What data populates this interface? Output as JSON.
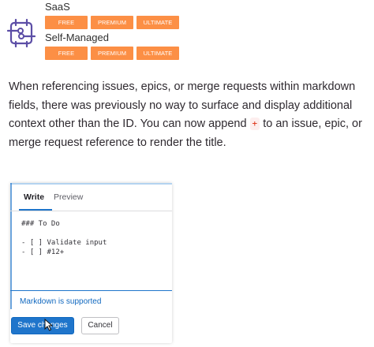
{
  "tiers": {
    "saas": {
      "title": "SaaS",
      "badges": [
        "FREE",
        "PREMIUM",
        "ULTIMATE"
      ]
    },
    "self_managed": {
      "title": "Self-Managed",
      "badges": [
        "FREE",
        "PREMIUM",
        "ULTIMATE"
      ]
    }
  },
  "description": {
    "before": "When referencing issues, epics, or merge requests within markdown fields, there was previously no way to surface and display additional context other than the ID. You can now append",
    "code": "+",
    "after": "to an issue, epic, or merge request reference to render the title."
  },
  "editor": {
    "tabs": {
      "write": "Write",
      "preview": "Preview"
    },
    "content": "### To Do\n\n- [ ] Validate input\n- [ ] #12+",
    "markdown_note": "Markdown is supported"
  },
  "buttons": {
    "save": "Save changes",
    "cancel": "Cancel"
  },
  "colors": {
    "badge": "#fc8f45",
    "accent": "#1f75cb",
    "code": "#dd2b0e"
  }
}
